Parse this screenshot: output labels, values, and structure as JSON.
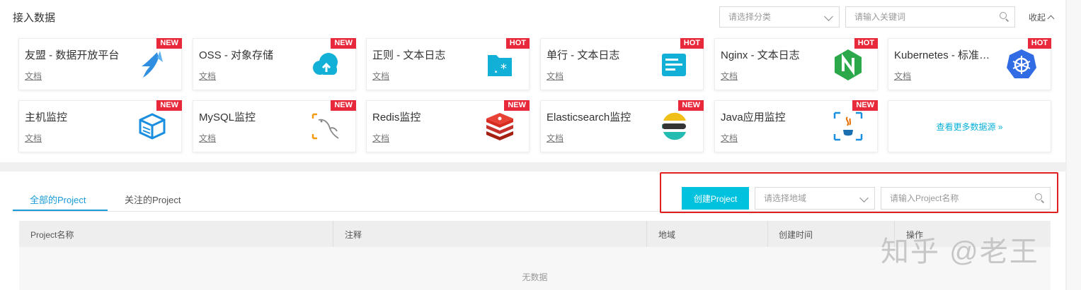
{
  "header": {
    "title": "接入数据",
    "category_placeholder": "请选择分类",
    "keyword_placeholder": "请输入关键词",
    "collapse_label": "收起"
  },
  "cards": [
    {
      "name": "友盟 - 数据开放平台",
      "doc": "文档",
      "badge": "NEW",
      "icon": "umeng-icon"
    },
    {
      "name": "OSS - 对象存储",
      "doc": "文档",
      "badge": "NEW",
      "icon": "oss-cloud-icon"
    },
    {
      "name": "正则 - 文本日志",
      "doc": "文档",
      "badge": "HOT",
      "icon": "regex-folder-icon"
    },
    {
      "name": "单行 - 文本日志",
      "doc": "文档",
      "badge": "HOT",
      "icon": "single-line-log-icon"
    },
    {
      "name": "Nginx - 文本日志",
      "doc": "文档",
      "badge": "HOT",
      "icon": "nginx-icon"
    },
    {
      "name": "Kubernetes - 标准输出",
      "doc": "文档",
      "badge": "HOT",
      "icon": "kubernetes-icon"
    },
    {
      "name": "主机监控",
      "doc": "文档",
      "badge": "NEW",
      "icon": "host-monitor-icon"
    },
    {
      "name": "MySQL监控",
      "doc": "文档",
      "badge": "NEW",
      "icon": "mysql-icon"
    },
    {
      "name": "Redis监控",
      "doc": "文档",
      "badge": "NEW",
      "icon": "redis-icon"
    },
    {
      "name": "Elasticsearch监控",
      "doc": "文档",
      "badge": "NEW",
      "icon": "elasticsearch-icon"
    },
    {
      "name": "Java应用监控",
      "doc": "文档",
      "badge": "NEW",
      "icon": "java-icon"
    }
  ],
  "more_sources": "查看更多数据源 »",
  "project": {
    "tabs": [
      {
        "label": "全部的Project",
        "active": true
      },
      {
        "label": "关注的Project",
        "active": false
      }
    ],
    "create_button": "创建Project",
    "region_placeholder": "请选择地域",
    "name_placeholder": "请输入Project名称",
    "columns": [
      "Project名称",
      "注释",
      "地域",
      "创建时间",
      "操作"
    ],
    "empty_text": "无数据"
  },
  "watermark": "知乎 @老王",
  "colors": {
    "accent": "#00c1de",
    "tab_active": "#1a9bd7",
    "badge": "#e8293b",
    "highlight": "#e02020"
  }
}
